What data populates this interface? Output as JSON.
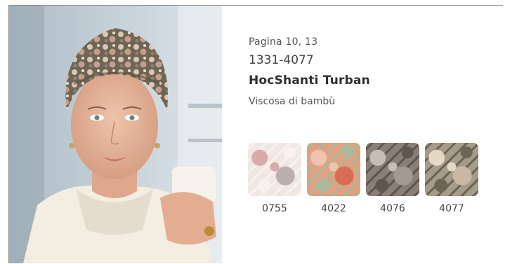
{
  "product": {
    "page_ref": "Pagina 10, 13",
    "code": "1331-4077",
    "name": "HocShanti Turban",
    "material": "Viscosa di bambù"
  },
  "colors": {
    "text": "#3a3a3a",
    "border": "#8a8a8a",
    "background": "#ffffff"
  },
  "swatches": [
    {
      "code": "0755",
      "palette": [
        "#f1e7e2",
        "#d9a9ab",
        "#f8f1ee",
        "#b9b0ad"
      ]
    },
    {
      "code": "4022",
      "palette": [
        "#e3a081",
        "#efc3ad",
        "#a8b89a",
        "#d86d56"
      ]
    },
    {
      "code": "4076",
      "palette": [
        "#8a7f77",
        "#c6bdb4",
        "#5f564f",
        "#a49a91"
      ]
    },
    {
      "code": "4077",
      "palette": [
        "#a69c8a",
        "#e5d8c4",
        "#6d6554",
        "#c9b8a3"
      ]
    }
  ]
}
